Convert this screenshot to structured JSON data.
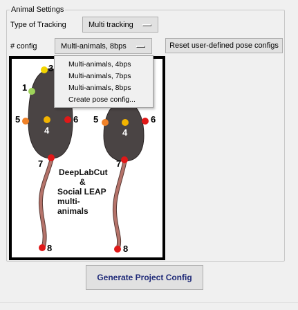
{
  "settings": {
    "group_title": "Animal Settings",
    "tracking_label": "Type of Tracking",
    "tracking_value": "Multi tracking",
    "config_label": "# config",
    "config_value": "Multi-animals, 8bps",
    "reset_label": "Reset user-defined pose configs"
  },
  "config_menu": {
    "items": [
      "Multi-animals, 4bps",
      "Multi-animals, 7bps",
      "Multi-animals, 8bps",
      "Create pose config..."
    ]
  },
  "diagram": {
    "caption_lines": [
      "DeepLabCut",
      "&",
      "Social LEAP",
      "multi-",
      "animals"
    ],
    "left_animal_points": [
      "1",
      "3",
      "4",
      "5",
      "6",
      "7",
      "8"
    ],
    "right_animal_points": [
      "4",
      "5",
      "6",
      "7",
      "8"
    ]
  },
  "actions": {
    "generate_label": "Generate Project Config"
  },
  "colors": {
    "body": "#4a4444",
    "tail": "#b5736a",
    "point_yellow": "#f2d400",
    "point_green": "#9ed35a",
    "point_orange": "#f08228",
    "point_red": "#e01818",
    "button_text": "#1f2a78"
  }
}
